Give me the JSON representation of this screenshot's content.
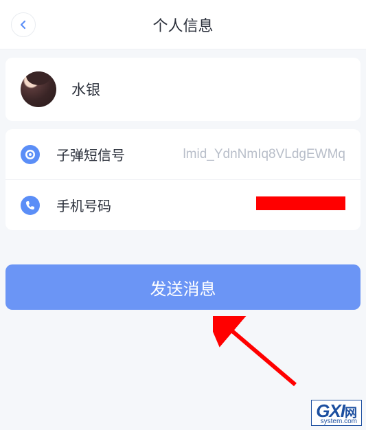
{
  "header": {
    "title": "个人信息"
  },
  "profile": {
    "username": "水银"
  },
  "info": {
    "sms_id_label": "子弹短信号",
    "sms_id_value": "lmid_YdnNmIq8VLdgEWMq",
    "phone_label": "手机号码"
  },
  "actions": {
    "send_message": "发送消息"
  },
  "watermark": {
    "brand": "GXI",
    "suffix": "网",
    "sub": "system.com"
  }
}
